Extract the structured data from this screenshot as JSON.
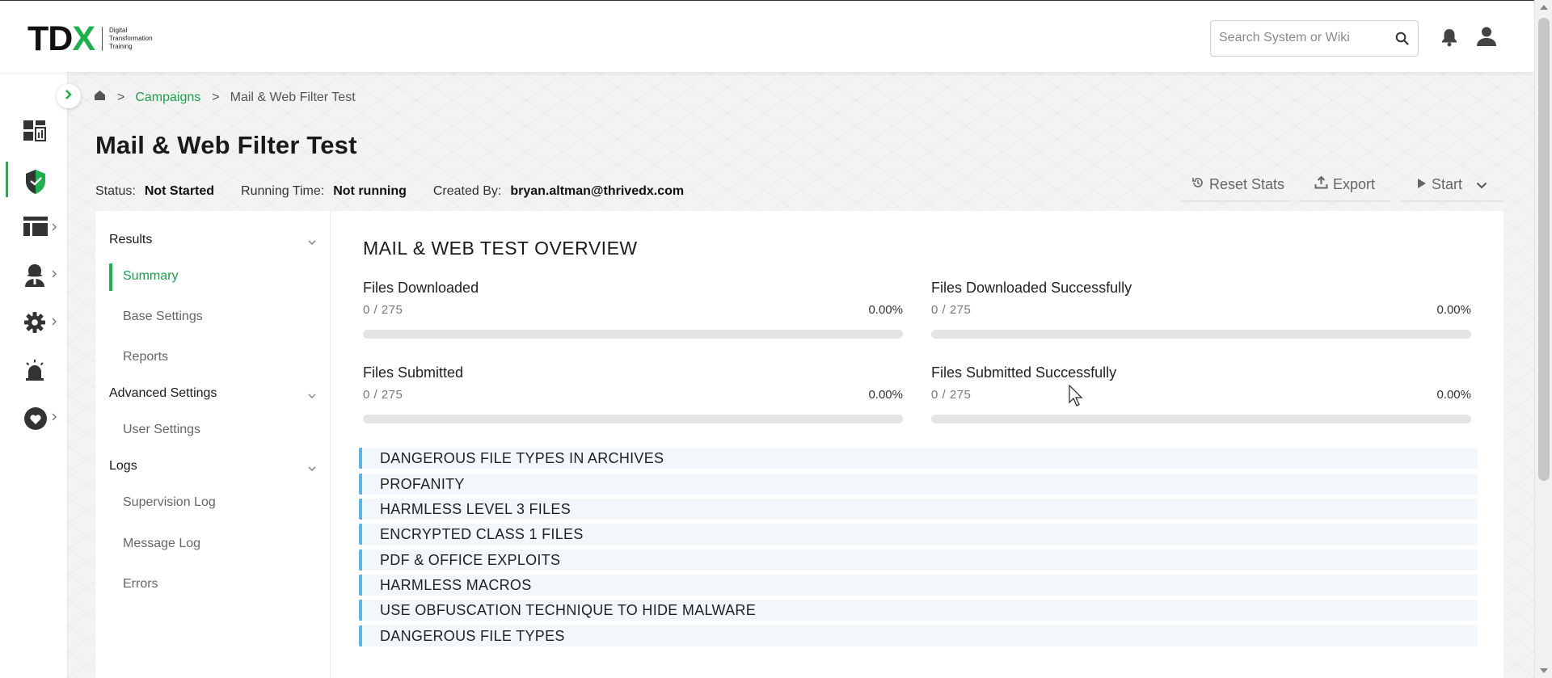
{
  "header": {
    "logo": {
      "mark_t": "T",
      "mark_d": "D",
      "mark_x": "X",
      "subtitle": "Digital Transformation Training"
    },
    "search_placeholder": "Search System or Wiki",
    "icons": [
      "search-icon",
      "bell-icon",
      "user-icon"
    ]
  },
  "rail": {
    "items": [
      {
        "icon": "dashboard-icon",
        "has_chevron": false
      },
      {
        "icon": "shield-icon",
        "has_chevron": false,
        "active": true
      },
      {
        "icon": "layout-icon",
        "has_chevron": true
      },
      {
        "icon": "hacker-icon",
        "has_chevron": true
      },
      {
        "icon": "gear-icon",
        "has_chevron": true
      },
      {
        "icon": "alarm-icon",
        "has_chevron": false
      },
      {
        "icon": "heart-icon",
        "has_chevron": true
      }
    ]
  },
  "breadcrumb": {
    "home_icon": "home-icon",
    "sep": ">",
    "campaigns": "Campaigns",
    "current": "Mail & Web Filter Test"
  },
  "page": {
    "title": "Mail & Web Filter Test",
    "status_label": "Status:",
    "status_value": "Not Started",
    "running_label": "Running Time:",
    "running_value": "Not running",
    "created_label": "Created By:",
    "created_value": "bryan.altman@thrivedx.com"
  },
  "actions": {
    "reset": "Reset Stats",
    "export": "Export",
    "start": "Start"
  },
  "subnav": {
    "results": "Results",
    "summary": "Summary",
    "base_settings": "Base Settings",
    "reports": "Reports",
    "advanced": "Advanced Settings",
    "user_settings": "User Settings",
    "logs": "Logs",
    "supervision_log": "Supervision Log",
    "message_log": "Message Log",
    "errors": "Errors"
  },
  "overview": {
    "title": "MAIL & WEB TEST OVERVIEW",
    "stats": [
      {
        "name": "Files Downloaded",
        "count": "0 / 275",
        "pct": "0.00%",
        "progress": 0
      },
      {
        "name": "Files Downloaded Successfully",
        "count": "0 / 275",
        "pct": "0.00%",
        "progress": 0
      },
      {
        "name": "Files Submitted",
        "count": "0 / 275",
        "pct": "0.00%",
        "progress": 0
      },
      {
        "name": "Files Submitted Successfully",
        "count": "0 / 275",
        "pct": "0.00%",
        "progress": 0
      }
    ],
    "categories": [
      "DANGEROUS FILE TYPES IN ARCHIVES",
      "PROFANITY",
      "HARMLESS LEVEL 3 FILES",
      "ENCRYPTED CLASS 1 FILES",
      "PDF & OFFICE EXPLOITS",
      "HARMLESS MACROS",
      "USE OBFUSCATION TECHNIQUE TO HIDE MALWARE",
      "DANGEROUS FILE TYPES"
    ]
  },
  "colors": {
    "brand_green": "#1eb04c",
    "link_green": "#1e9e4a",
    "category_accent": "#5ab4e5",
    "category_bg": "#f2f7fb"
  }
}
